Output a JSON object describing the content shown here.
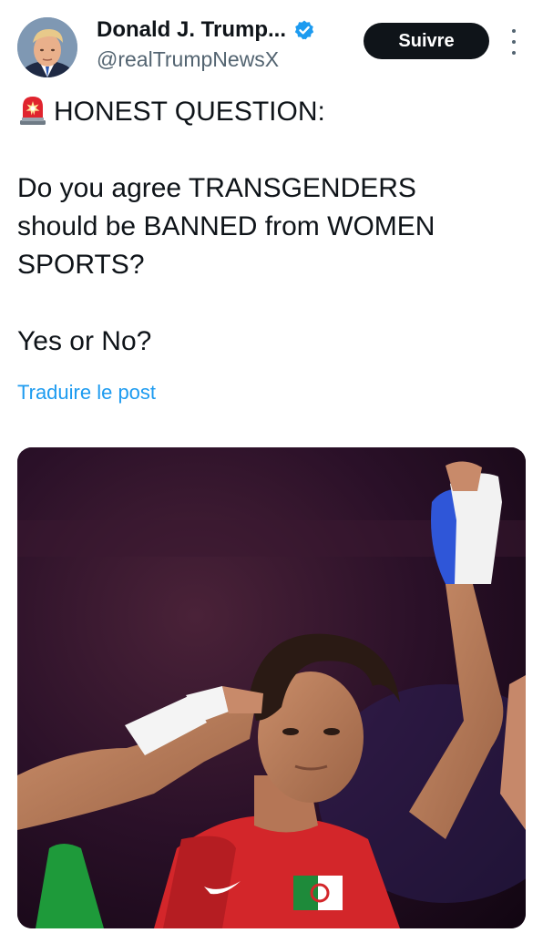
{
  "post": {
    "author": {
      "display_name": "Donald J. Trump...",
      "handle": "@realTrumpNewsX",
      "verified": true
    },
    "follow_label": "Suivre",
    "text": {
      "headline": "HONEST QUESTION:",
      "headline_emoji": "siren-icon",
      "body_line1": "Do you agree TRANSGENDERS",
      "body_line2": "should be BANNED from WOMEN",
      "body_line3": "SPORTS?",
      "closing": "Yes or No?"
    },
    "translate_label": "Traduire le post",
    "media": {
      "type": "photo"
    }
  },
  "colors": {
    "follow_bg": "#0f1419",
    "link": "#1d9bf0",
    "verified": "#1d9bf0",
    "secondary_text": "#536471"
  }
}
